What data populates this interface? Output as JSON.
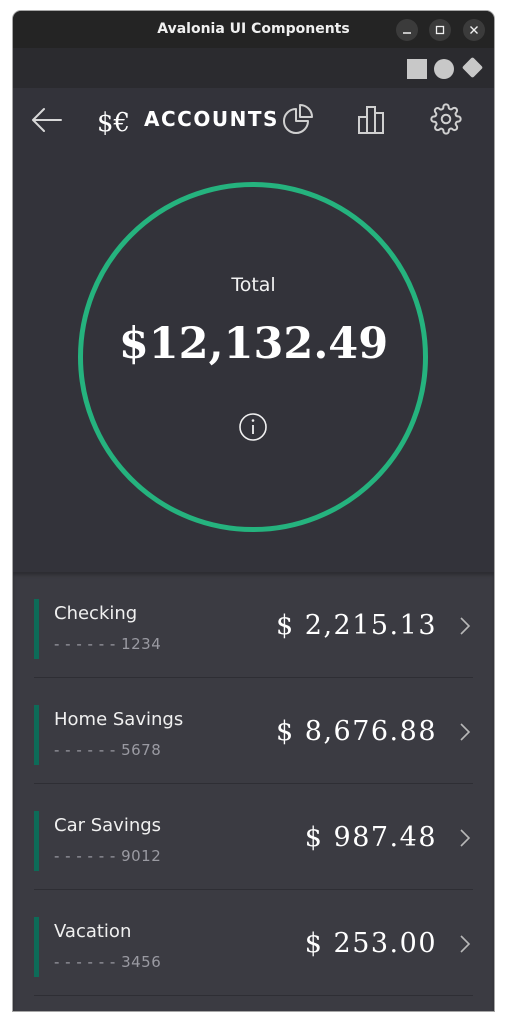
{
  "window": {
    "title": "Avalonia UI Components"
  },
  "header": {
    "brand_mark": "$€",
    "title": "ACCOUNTS"
  },
  "summary": {
    "label": "Total",
    "value": "$12,132.49"
  },
  "accounts": [
    {
      "name": "Checking",
      "masked_number": "- - - - - - 1234",
      "amount": "$ 2,215.13"
    },
    {
      "name": "Home Savings",
      "masked_number": "- - - - - - 5678",
      "amount": "$ 8,676.88"
    },
    {
      "name": "Car Savings",
      "masked_number": "- - - - - - 9012",
      "amount": "$ 987.48"
    },
    {
      "name": "Vacation",
      "masked_number": "- - - - - - 3456",
      "amount": "$ 253.00"
    }
  ],
  "colors": {
    "accent_ring": "#25b37e",
    "account_bar": "#0d6b58",
    "background": "#33333a",
    "list_background": "#3b3b42"
  },
  "icons": {
    "back": "arrow-left-icon",
    "pie": "pie-chart-icon",
    "bars": "bar-chart-icon",
    "settings": "gear-icon",
    "info": "info-icon",
    "row": "chevron-right-icon"
  }
}
